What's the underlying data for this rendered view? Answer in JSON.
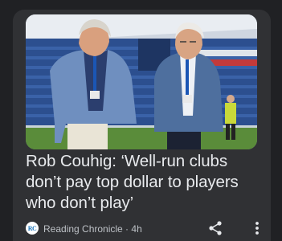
{
  "article": {
    "image_icon": "photo-two-men-stadium",
    "headline": "Rob Couhig: ‘Well-run clubs don’t pay top dollar to players who don’t play’",
    "source_logo_text": "RC",
    "source_line": "Reading Chronicle · 4h",
    "share_icon": "share-icon",
    "more_icon": "more-vert-icon"
  },
  "colors": {
    "background": "#202124",
    "card": "#303134",
    "headline_text": "#e8eaed",
    "meta_text": "#bdc1c6"
  }
}
